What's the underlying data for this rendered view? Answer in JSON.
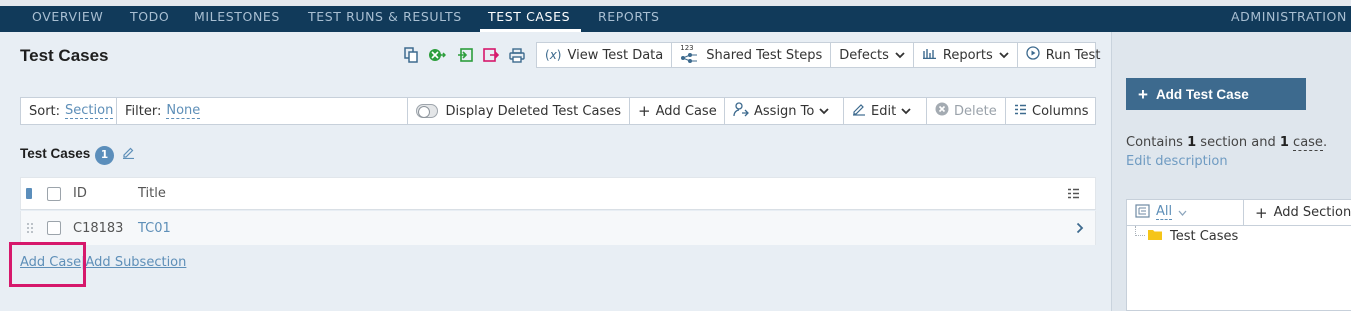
{
  "nav": {
    "items": [
      "OVERVIEW",
      "TODO",
      "MILESTONES",
      "TEST RUNS & RESULTS",
      "TEST CASES",
      "REPORTS"
    ],
    "active": "TEST CASES",
    "admin": "ADMINISTRATION"
  },
  "page": {
    "title": "Test Cases"
  },
  "toolbar": {
    "view_test_data": "View Test Data",
    "shared_steps_badge": "123",
    "shared_steps": "Shared Test Steps",
    "defects": "Defects",
    "reports": "Reports",
    "run_test": "Run Test"
  },
  "filterbar": {
    "sort_label": "Sort:",
    "sort_value": "Section",
    "filter_label": "Filter:",
    "filter_value": "None",
    "display_deleted": "Display Deleted Test Cases",
    "add_case": "Add Case",
    "assign_to": "Assign To",
    "edit": "Edit",
    "delete": "Delete",
    "columns": "Columns"
  },
  "section": {
    "title": "Test Cases",
    "count": "1"
  },
  "table": {
    "headers": {
      "id": "ID",
      "title": "Title"
    },
    "rows": [
      {
        "id": "C18183",
        "title": "TC01"
      }
    ]
  },
  "bottom_links": {
    "add_case": "Add Case",
    "separator": "|",
    "add_subsection": "Add Subsection"
  },
  "sidebar": {
    "add_test_case": "Add Test Case",
    "contains_prefix": "Contains",
    "sections_count": "1",
    "sections_word": "section and",
    "cases_count": "1",
    "cases_word": "case",
    "period": ".",
    "edit_description": "Edit description",
    "tree_filter": "All",
    "add_section": "Add Section",
    "tree_items": [
      "Test Cases"
    ]
  },
  "colors": {
    "nav_bg": "#113a5a",
    "accent_blue": "#5e8fb8",
    "primary_button": "#3d6a8e",
    "highlight": "#d6186b",
    "folder": "#f5c518",
    "badge": "#5b8ebb"
  }
}
